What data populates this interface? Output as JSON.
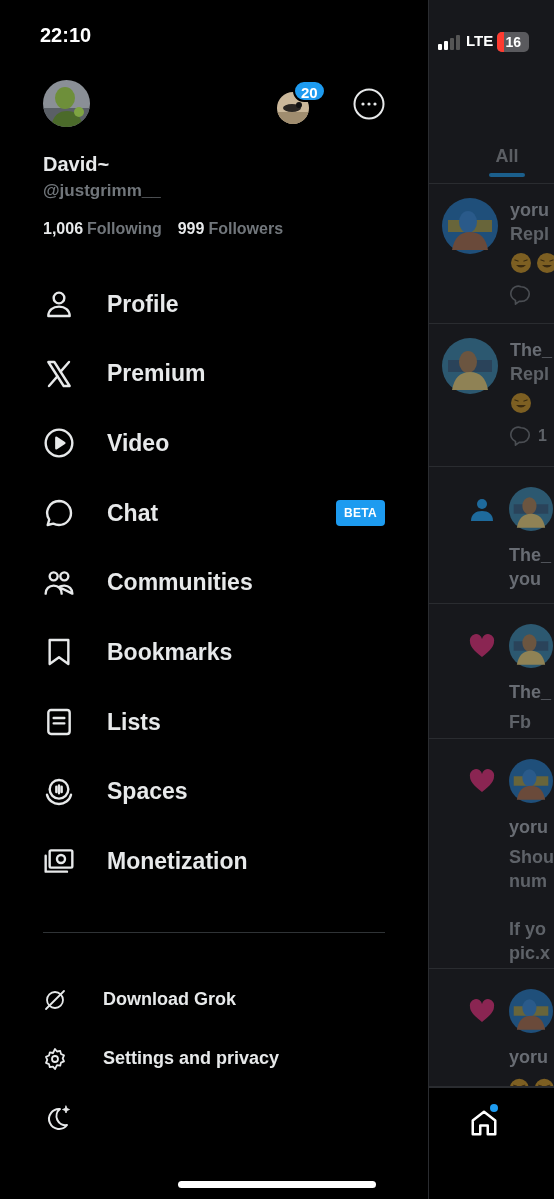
{
  "status_bar": {
    "time": "22:10",
    "network": "LTE",
    "battery": "16"
  },
  "profile": {
    "name": "David~",
    "handle": "@justgrimm__",
    "following_count": "1,006",
    "following_label": "Following",
    "followers_count": "999",
    "followers_label": "Followers",
    "accounts_badge": "20"
  },
  "menu": [
    {
      "label": "Profile"
    },
    {
      "label": "Premium"
    },
    {
      "label": "Video"
    },
    {
      "label": "Chat",
      "badge": "BETA"
    },
    {
      "label": "Communities"
    },
    {
      "label": "Bookmarks"
    },
    {
      "label": "Lists"
    },
    {
      "label": "Spaces"
    },
    {
      "label": "Monetization"
    }
  ],
  "secondary_menu": [
    {
      "label": "Download Grok"
    },
    {
      "label": "Settings and privacy"
    }
  ],
  "background": {
    "tabs": [
      {
        "label": "All",
        "selected": true
      }
    ],
    "notifications": [
      {
        "kind": "reply",
        "name": "yoru",
        "text": "Repl",
        "emoji_reaction": true
      },
      {
        "kind": "reply",
        "name": "The_",
        "text": "Repl",
        "emoji_reaction": true,
        "reply_count": "1"
      },
      {
        "kind": "follow",
        "lines": [
          "The_",
          "you"
        ]
      },
      {
        "kind": "like",
        "name": "The_",
        "paragraphs": [
          [
            "Fb"
          ]
        ]
      },
      {
        "kind": "like",
        "name": "yoru",
        "paragraphs": [
          [
            "Shou",
            "num"
          ],
          [
            "If yo",
            "pic.x"
          ]
        ]
      },
      {
        "kind": "like",
        "name": "yoru",
        "emoji_reaction": true
      }
    ],
    "home_unread": true
  }
}
